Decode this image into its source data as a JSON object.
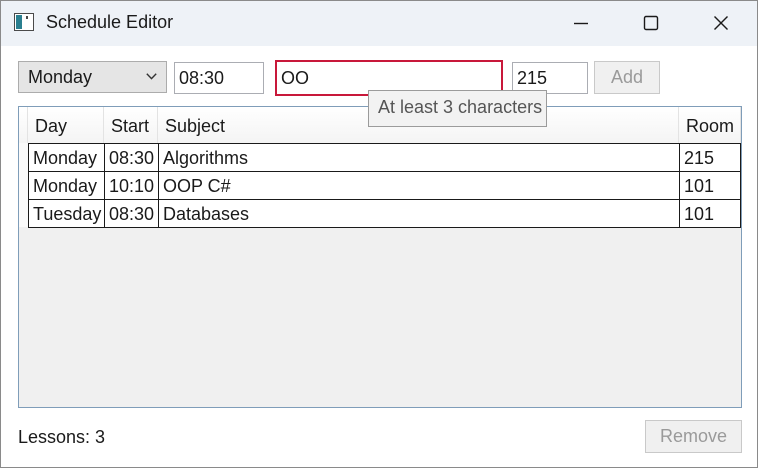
{
  "window": {
    "title": "Schedule Editor",
    "icons": {
      "app": "window-app-icon",
      "minimize": "minimize-icon",
      "maximize": "maximize-icon",
      "close": "close-icon"
    }
  },
  "toolbar": {
    "day_selected": "Monday",
    "start_value": "08:30",
    "subject_value": "OO",
    "room_value": "215",
    "add_label": "Add",
    "validation_tooltip": "At least 3 characters",
    "invalid_border_color": "#c8183a"
  },
  "grid": {
    "columns": [
      "Day",
      "Start",
      "Subject",
      "Room"
    ],
    "rows": [
      [
        "Monday",
        "08:30",
        "Algorithms",
        "215"
      ],
      [
        "Monday",
        "10:10",
        "OOP C#",
        "101"
      ],
      [
        "Tuesday",
        "08:30",
        "Databases",
        "101"
      ]
    ]
  },
  "footer": {
    "status": "Lessons: 3",
    "remove_label": "Remove"
  }
}
